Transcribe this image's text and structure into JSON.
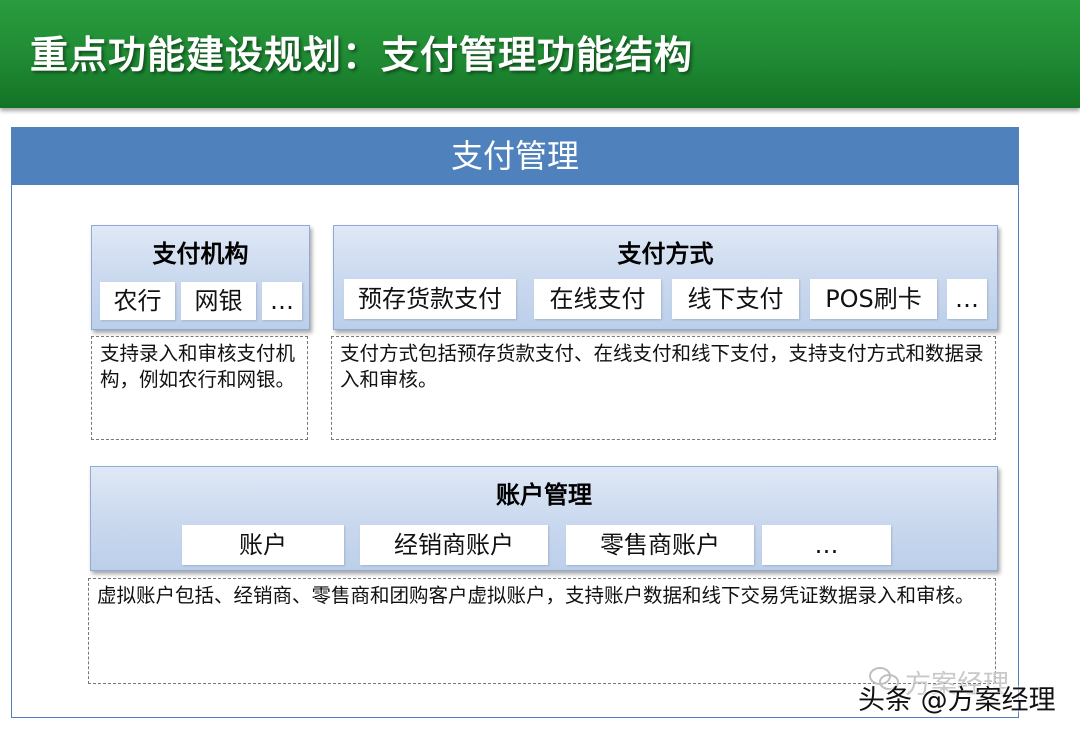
{
  "title": "重点功能建设规划：支付管理功能结构",
  "header": "支付管理",
  "institutions": {
    "title": "支付机构",
    "items": [
      "农行",
      "网银",
      "…"
    ],
    "description": "支持录入和审核支付机构，例如农行和网银。"
  },
  "methods": {
    "title": "支付方式",
    "items": [
      "预存货款支付",
      "在线支付",
      "线下支付",
      "POS刷卡",
      "…"
    ],
    "description": "支付方式包括预存货款支付、在线支付和线下支付，支持支付方式和数据录入和审核。"
  },
  "accounts": {
    "title": "账户管理",
    "items": [
      "账户",
      "经销商账户",
      "零售商账户",
      "…"
    ],
    "description": "虚拟账户包括、经销商、零售商和团购客户虚拟账户，支持账户数据和线下交易凭证数据录入和审核。"
  },
  "watermark": {
    "faint": "方案经理",
    "main": "头条 @方案经理"
  },
  "colors": {
    "title_bar": "#1f8a33",
    "header": "#4f81bd",
    "panel": "#c9d8ee"
  }
}
